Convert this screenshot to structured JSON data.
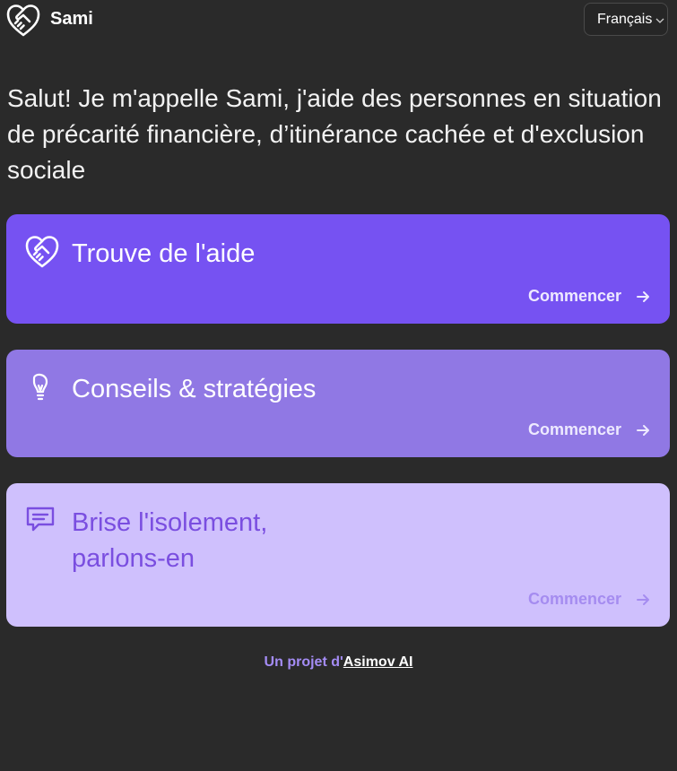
{
  "app": {
    "name": "Sami",
    "logo_icon": "handshake-heart-icon"
  },
  "language_select": {
    "selected": "Français",
    "icon": "chevron-down-icon"
  },
  "intro": {
    "text": "Salut! Je m'appelle Sami, j'aide des personnes en situation de précarité financière, d’itinérance cachée et d'exclusion sociale"
  },
  "cards": [
    {
      "title": "Trouve de l'aide",
      "cta": "Commencer",
      "icon": "handshake-heart-icon",
      "color": "#7652f2"
    },
    {
      "title": "Conseils & stratégies",
      "cta": "Commencer",
      "icon": "lightbulb-icon",
      "color": "#9078e4"
    },
    {
      "title_line1": "Brise l'isolement,",
      "title_line2": "parlons-en",
      "cta": "Commencer",
      "icon": "chat-icon",
      "color": "#cfc0fd"
    }
  ],
  "footer": {
    "prefix": "Un projet d'",
    "link": "Asimov AI"
  }
}
